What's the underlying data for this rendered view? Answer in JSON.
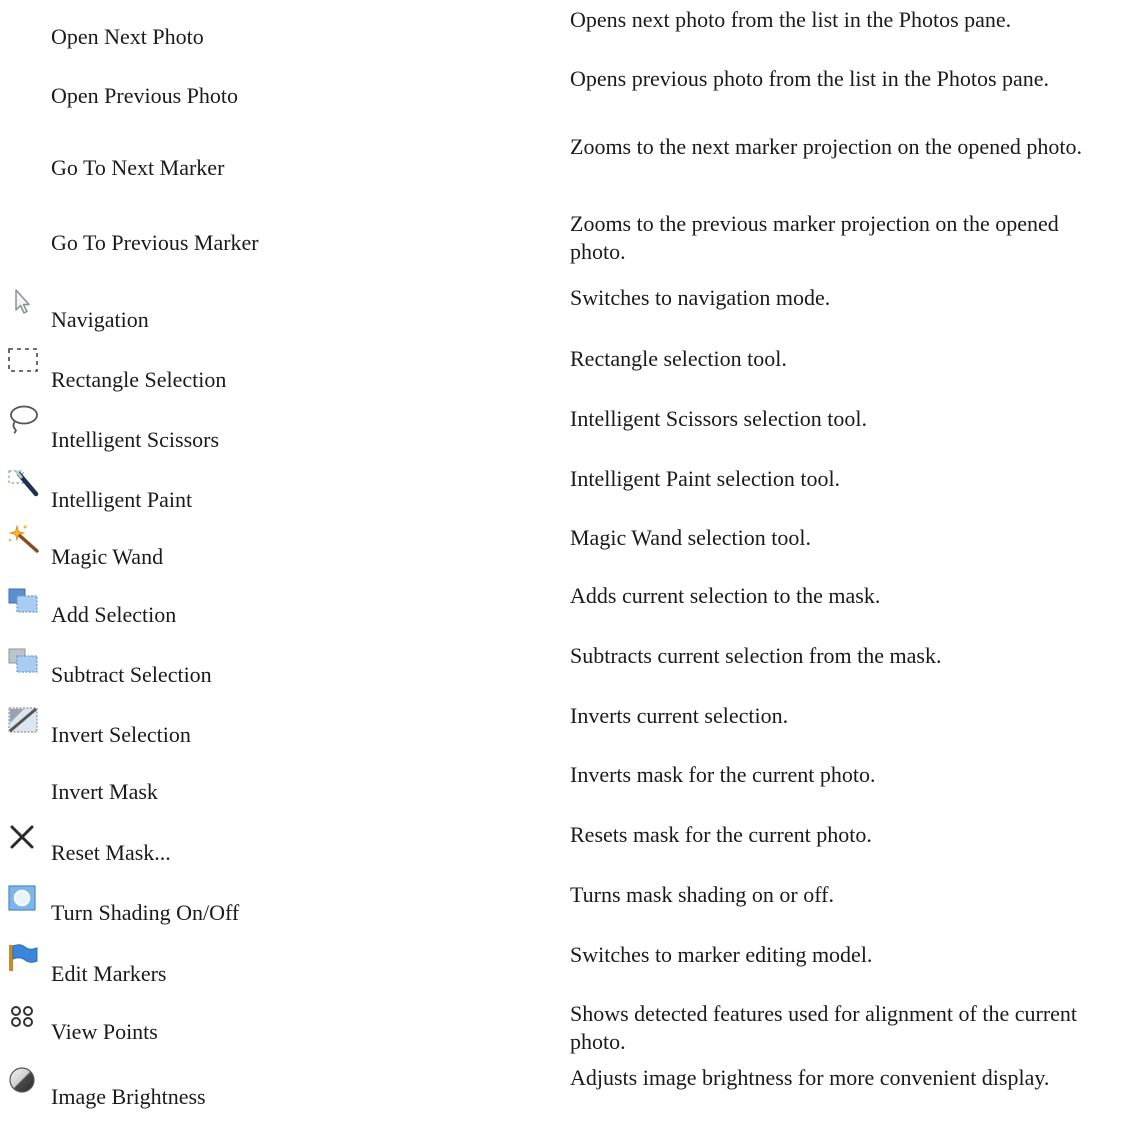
{
  "rows": [
    {
      "label": "Open Next Photo",
      "icon": "none",
      "description": "Opens next photo from the list in the Photos pane."
    },
    {
      "label": "Open Previous Photo",
      "icon": "none",
      "description": "Opens previous photo from the list in the Photos pane."
    },
    {
      "label": "Go To Next Marker",
      "icon": "none",
      "description": "Zooms to the next marker projection on the opened photo."
    },
    {
      "label": "Go To Previous Marker",
      "icon": "none",
      "description": "Zooms to the previous marker projection on the opened photo."
    },
    {
      "label": "Navigation",
      "icon": "arrow-cursor-icon",
      "description": "Switches to navigation mode."
    },
    {
      "label": "Rectangle Selection",
      "icon": "rectangle-selection-icon",
      "description": "Rectangle selection tool."
    },
    {
      "label": "Intelligent Scissors",
      "icon": "lasso-icon",
      "description": "Intelligent Scissors selection tool."
    },
    {
      "label": "Intelligent Paint",
      "icon": "paint-brush-icon",
      "description": "Intelligent Paint selection tool."
    },
    {
      "label": "Magic Wand",
      "icon": "magic-wand-icon",
      "description": "Magic Wand selection tool."
    },
    {
      "label": "Add Selection",
      "icon": "add-selection-icon",
      "description": "Adds current selection to the mask."
    },
    {
      "label": "Subtract Selection",
      "icon": "subtract-selection-icon",
      "description": "Subtracts current selection from the mask."
    },
    {
      "label": "Invert Selection",
      "icon": "invert-selection-icon",
      "description": "Inverts current selection."
    },
    {
      "label": "Invert Mask",
      "icon": "none",
      "description": "Inverts mask for the current photo."
    },
    {
      "label": "Reset Mask...",
      "icon": "close-x-icon",
      "description": "Resets mask for the current photo."
    },
    {
      "label": "Turn Shading On/Off",
      "icon": "shading-icon",
      "description": "Turns mask shading on or off."
    },
    {
      "label": "Edit Markers",
      "icon": "flag-icon",
      "description": "Switches to marker editing model."
    },
    {
      "label": "View Points",
      "icon": "points-grid-icon",
      "description": "Shows detected features used for alignment of the current photo."
    },
    {
      "label": "Image Brightness",
      "icon": "brightness-icon",
      "description": "Adjusts image brightness for more convenient display."
    }
  ]
}
